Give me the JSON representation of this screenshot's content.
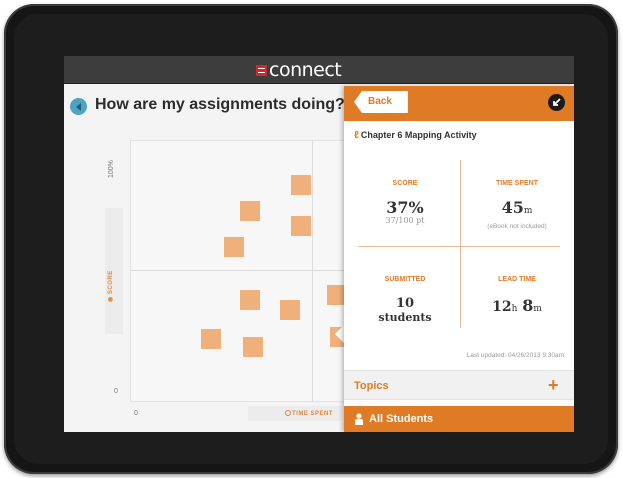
{
  "app": {
    "logo_text": "connect"
  },
  "header": {
    "question": "How are my assignments doing?"
  },
  "chart_data": {
    "type": "scatter",
    "xlabel": "TIME SPENT",
    "ylabel": "SCORE",
    "y_ticks": [
      "100%",
      "0"
    ],
    "x_ticks": [
      "0"
    ],
    "points": [
      {
        "x": 0.61,
        "y": 0.83
      },
      {
        "x": 0.43,
        "y": 0.73
      },
      {
        "x": 0.61,
        "y": 0.67
      },
      {
        "x": 0.37,
        "y": 0.59
      },
      {
        "x": 0.43,
        "y": 0.39
      },
      {
        "x": 0.57,
        "y": 0.35
      },
      {
        "x": 0.74,
        "y": 0.41
      },
      {
        "x": 0.29,
        "y": 0.24
      },
      {
        "x": 0.44,
        "y": 0.21
      },
      {
        "x": 0.75,
        "y": 0.25
      }
    ]
  },
  "panel": {
    "back_label": "Back",
    "chapter": "Chapter 6 Mapping Activity",
    "stats": {
      "score_label": "SCORE",
      "score_value": "37%",
      "score_sub": "37/100 pt",
      "time_label": "TIME SPENT",
      "time_value": "45",
      "time_unit": "m",
      "time_note": "(eBook not included)",
      "submitted_label": "SUBMITTED",
      "submitted_value": "10",
      "submitted_unit": "students",
      "lead_label": "LEAD TIME",
      "lead_hours": "12",
      "lead_h": "h",
      "lead_minutes": "8",
      "lead_m": "m"
    },
    "updated": "Last updated: 04/26/2013 9:30am",
    "topics_label": "Topics",
    "students_label": "All Students"
  },
  "colors": {
    "accent": "#e07b25",
    "marker": "#f0b07c",
    "topbar": "#3d3d3d"
  }
}
